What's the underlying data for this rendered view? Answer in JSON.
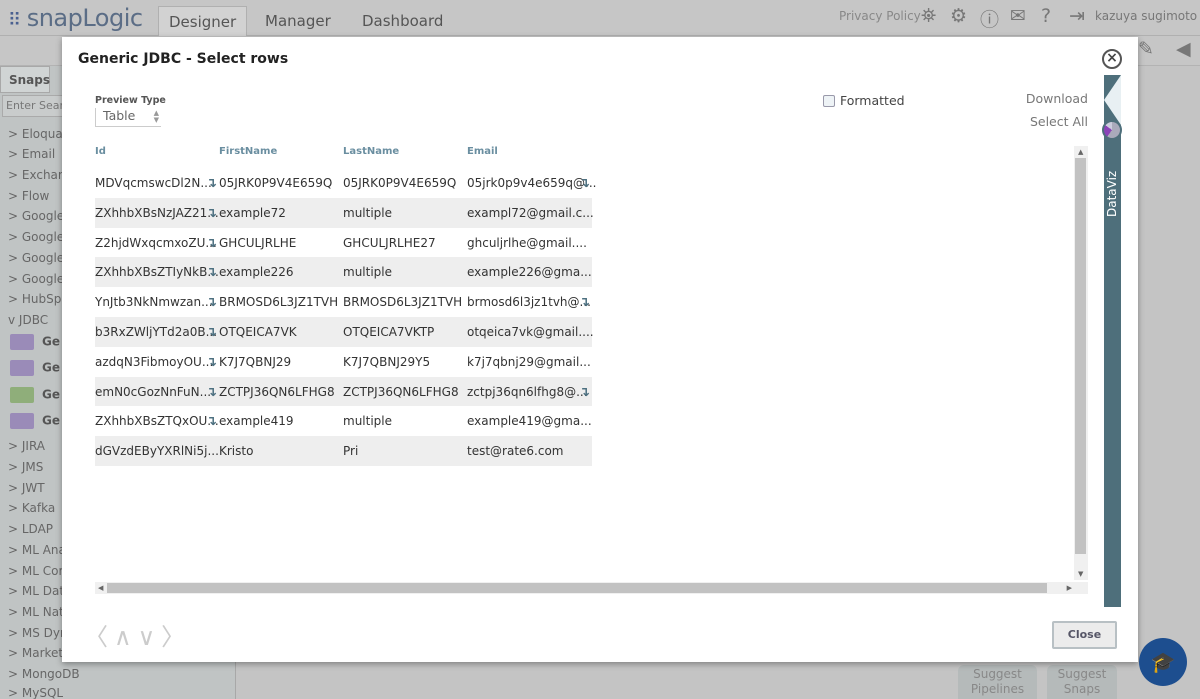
{
  "app": {
    "logo": "snapLogic",
    "tabs": [
      "Designer",
      "Manager",
      "Dashboard"
    ],
    "active_tab": "Designer",
    "privacy": "Privacy Policy",
    "user": "kazuya sugimoto",
    "icons": [
      "binoculars-icon",
      "gear-icon",
      "feedback-icon",
      "mail-icon",
      "help-icon",
      "logout-icon"
    ]
  },
  "sidebar": {
    "tab": "Snaps",
    "search_placeholder": "Enter Search",
    "items": [
      {
        "label": "> Eloqua"
      },
      {
        "label": "> Email"
      },
      {
        "label": "> Exchan"
      },
      {
        "label": "> Flow"
      },
      {
        "label": "> Google"
      },
      {
        "label": "> Google"
      },
      {
        "label": "> Google"
      },
      {
        "label": "> Google"
      },
      {
        "label": "> HubSp"
      },
      {
        "label": "v JDBC"
      },
      {
        "label": "Ge",
        "snap": true
      },
      {
        "label": "Ge",
        "snap": true
      },
      {
        "label": "Ge",
        "snap": true,
        "green": true
      },
      {
        "label": "Ge",
        "snap": true
      },
      {
        "label": "> JIRA"
      },
      {
        "label": "> JMS"
      },
      {
        "label": "> JWT"
      },
      {
        "label": "> Kafka"
      },
      {
        "label": "> LDAP"
      },
      {
        "label": "> ML Ana"
      },
      {
        "label": "> ML Cor"
      },
      {
        "label": "> ML Dat"
      },
      {
        "label": "> ML Nat"
      },
      {
        "label": "> MS Dyn"
      },
      {
        "label": "> Market"
      },
      {
        "label": "> MongoDB"
      },
      {
        "label": "> MySQL"
      }
    ]
  },
  "bottom": {
    "suggest_pipelines": "Suggest Pipelines",
    "suggest_snaps": "Suggest Snaps"
  },
  "modal": {
    "title": "Generic JDBC - Select rows",
    "preview_type_label": "Preview Type",
    "preview_type": "Table",
    "formatted": "Formatted",
    "formatted_checked": false,
    "download": "Download",
    "select_all": "Select All",
    "dataviz": "DataViz",
    "close": "Close",
    "columns": [
      "Id",
      "FirstName",
      "LastName",
      "Email"
    ],
    "rows": [
      {
        "cells": [
          "MDVqcmswcDl2N...",
          "05JRK0P9V4E659Q",
          "05JRK0P9V4E659Q",
          "05jrk0p9v4e659q@..."
        ],
        "id_expand": true,
        "email_expand": true
      },
      {
        "cells": [
          "ZXhhbXBsNzJAZ21...",
          "example72",
          "multiple",
          "exampl72@gmail.c..."
        ],
        "id_expand": true,
        "email_expand": false
      },
      {
        "cells": [
          "Z2hjdWxqcmxoZU...",
          "GHCULJRLHE",
          "GHCULJRLHE27",
          "ghculjrlhe@gmail...."
        ],
        "id_expand": true,
        "email_expand": false
      },
      {
        "cells": [
          "ZXhhbXBsZTIyNkB...",
          "example226",
          "multiple",
          "example226@gma..."
        ],
        "id_expand": true,
        "email_expand": false
      },
      {
        "cells": [
          "YnJtb3NkNmwzan...",
          "BRMOSD6L3JZ1TVH",
          "BRMOSD6L3JZ1TVH",
          "brmosd6l3jz1tvh@..."
        ],
        "id_expand": true,
        "email_expand": true
      },
      {
        "cells": [
          "b3RxZWljYTd2a0B...",
          "OTQEICA7VK",
          "OTQEICA7VKTP",
          "otqeica7vk@gmail...."
        ],
        "id_expand": true,
        "email_expand": false
      },
      {
        "cells": [
          "azdqN3FibmoyOU...",
          "K7J7QBNJ29",
          "K7J7QBNJ29Y5",
          "k7j7qbnj29@gmail..."
        ],
        "id_expand": true,
        "email_expand": false
      },
      {
        "cells": [
          "emN0cGozNnFuN...",
          "ZCTPJ36QN6LFHG8",
          "ZCTPJ36QN6LFHG8",
          "zctpj36qn6lfhg8@..."
        ],
        "id_expand": true,
        "email_expand": true
      },
      {
        "cells": [
          "ZXhhbXBsZTQxOU...",
          "example419",
          "multiple",
          "example419@gma..."
        ],
        "id_expand": true,
        "email_expand": false
      },
      {
        "cells": [
          "dGVzdEByYXRlNi5j...",
          "Kristo",
          "Pri",
          "test@rate6.com"
        ],
        "id_expand": false,
        "email_expand": false
      }
    ]
  },
  "colors": {
    "dataviz": "#4e6f7b",
    "help_button": "#1d4e8f",
    "header_text": "#6a8ea0"
  }
}
